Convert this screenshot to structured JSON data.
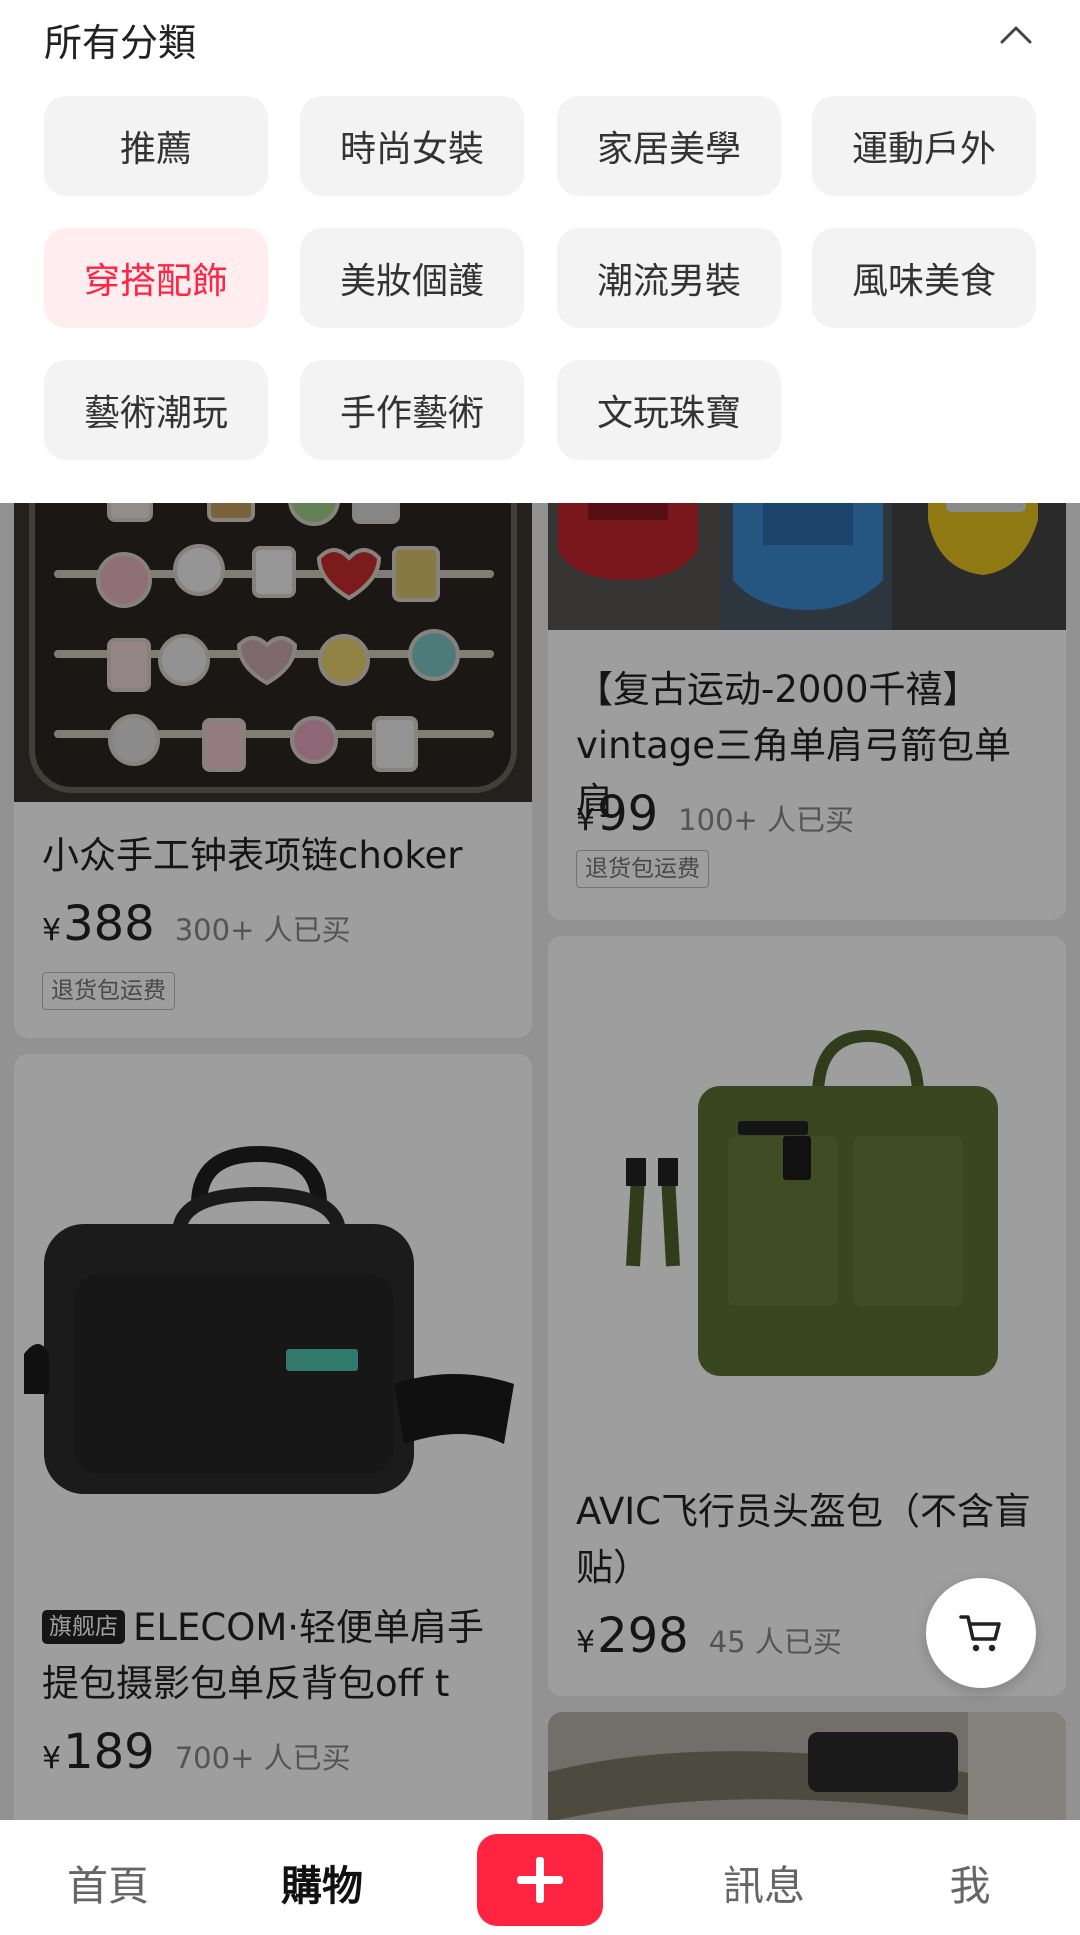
{
  "category_panel": {
    "title": "所有分類",
    "categories": [
      {
        "label": "推薦",
        "selected": false
      },
      {
        "label": "時尚女裝",
        "selected": false
      },
      {
        "label": "家居美學",
        "selected": false
      },
      {
        "label": "運動戶外",
        "selected": false
      },
      {
        "label": "穿搭配飾",
        "selected": true
      },
      {
        "label": "美妝個護",
        "selected": false
      },
      {
        "label": "潮流男裝",
        "selected": false
      },
      {
        "label": "風味美食",
        "selected": false
      },
      {
        "label": "藝術潮玩",
        "selected": false
      },
      {
        "label": "手作藝術",
        "selected": false
      },
      {
        "label": "文玩珠寶",
        "selected": false
      }
    ]
  },
  "products": [
    {
      "title": "小众手工钟表项链choker",
      "currency": "¥",
      "price": "388",
      "sold": "300+ 人已买",
      "tag": "退货包运费"
    },
    {
      "title": "【复古运动-2000千禧】vintage三角单肩弓箭包单肩",
      "currency": "¥",
      "price": "99",
      "sold": "100+ 人已买",
      "tag": "退货包运费"
    },
    {
      "badge": "旗舰店",
      "title": "ELECOM·轻便单肩手提包摄影包单反背包off t",
      "currency": "¥",
      "price": "189",
      "sold": "700+ 人已买"
    },
    {
      "title": "AVIC飞行员头盔包（不含盲贴）",
      "currency": "¥",
      "price": "298",
      "sold": "45 人已买"
    }
  ],
  "bottom_nav": {
    "home": "首頁",
    "shop": "購物",
    "messages": "訊息",
    "me": "我",
    "active": "購物"
  },
  "icons": {
    "collapse": "chevron-up-icon",
    "post": "plus-icon",
    "cart": "cart-icon"
  },
  "colors": {
    "accent": "#ff2442",
    "selected_chip_bg": "#ffedf0",
    "chip_bg": "#f3f3f3"
  }
}
